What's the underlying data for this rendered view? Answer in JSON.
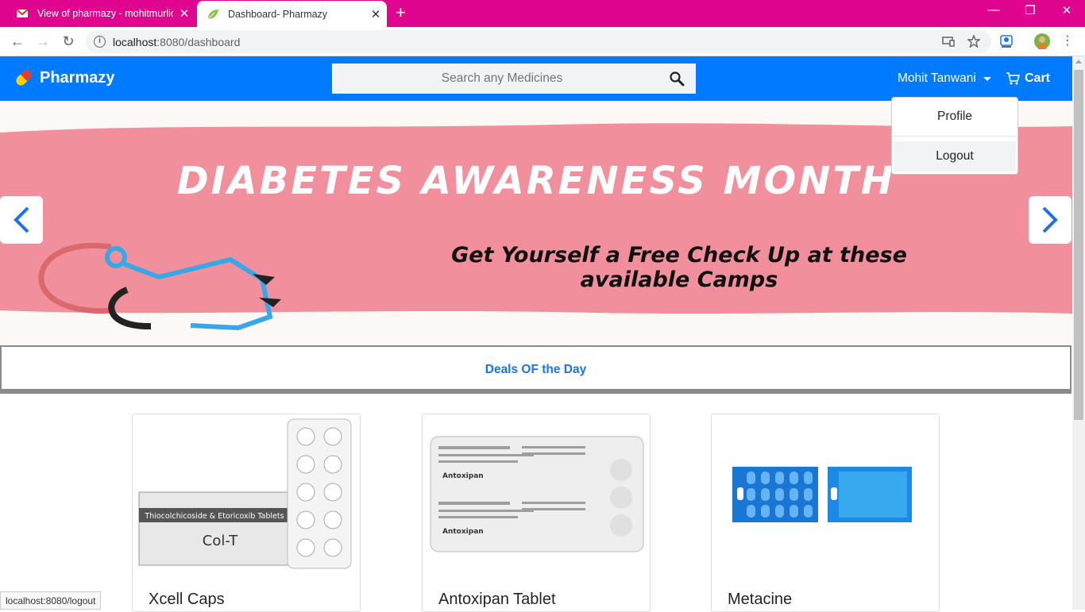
{
  "browser": {
    "tabs": [
      {
        "title": "View of pharmazy - mohitmurlidh",
        "close": "✕"
      },
      {
        "title": "Dashboard- Pharmazy",
        "close": "✕"
      }
    ],
    "new_tab": "+",
    "window_controls": {
      "minimize": "—",
      "restore": "❐",
      "close": "✕"
    },
    "url_host": "localhost",
    "url_rest": ":8080/dashboard",
    "nav": {
      "back": "←",
      "forward": "→",
      "reload": "↻"
    },
    "status_url": "localhost:8080/logout"
  },
  "navbar": {
    "brand": "Pharmazy",
    "search_placeholder": "Search any Medicines",
    "user_name": "Mohit Tanwani",
    "cart_label": "Cart",
    "accent": "#007bff"
  },
  "user_menu": {
    "profile": "Profile",
    "logout": "Logout"
  },
  "banner": {
    "headline": "DIABETES AWARENESS MONTH",
    "subline_1": "Get Yourself a Free Check Up at these",
    "subline_2": "available Camps",
    "stripe_color": "#f28f9d"
  },
  "deals_heading": "Deals OF the Day",
  "products": [
    {
      "name": "Xcell Caps",
      "pack_text": "Thiocolchicoside & Etoricoxib Tablets",
      "pack_brand": "Col-T"
    },
    {
      "name": "Antoxipan Tablet",
      "pack_brand": "Antoxipan"
    },
    {
      "name": "Metacine"
    }
  ]
}
